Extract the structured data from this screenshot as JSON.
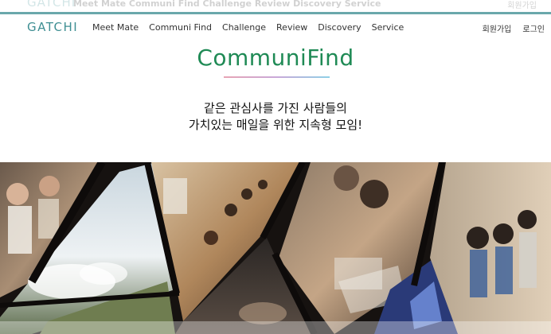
{
  "header": {
    "brand": "GATCHI",
    "nav": [
      "Meet Mate",
      "Communi Find",
      "Challenge",
      "Review",
      "Discovery",
      "Service"
    ],
    "auth": {
      "signup": "회원가입",
      "login": "로그인"
    },
    "ghost_nav": "Meet Mate  Communi Find   Challenge   Review   Discovery   Service",
    "ghost_right": "회원가입"
  },
  "hero": {
    "title": "CommuniFind",
    "tagline_line1": "같은 관심사를 가진 사람들의",
    "tagline_line2": "가치있는 매일을 위한 지속형 모임!"
  },
  "colors": {
    "accent_teal": "#6aa8ab",
    "brand": "#3f8f93",
    "title_green": "#1f8a55"
  }
}
